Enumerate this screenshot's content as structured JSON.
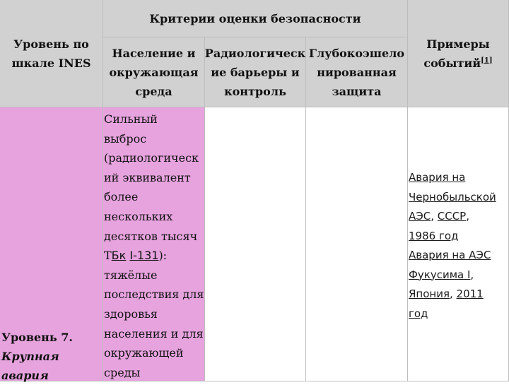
{
  "header": {
    "level_col": [
      "Уровень по",
      "шкале INES"
    ],
    "criteria": "Критерии оценки безопасности",
    "population_col": [
      "Население и",
      "окружающая",
      "среда"
    ],
    "radiological_col": [
      "Радиологическ",
      "ие барьеры и",
      "контроль"
    ],
    "deep_col": [
      "Глубокоэшело",
      "нированная",
      "защита"
    ],
    "examples_col": [
      "Примеры",
      "событий"
    ],
    "examples_ref": "[1]"
  },
  "row7": {
    "level_title": "Уровень 7.",
    "level_subtitle": "Крупная авария",
    "description": {
      "lines_before": [
        "Сильный",
        "выброс",
        "(радиологическ",
        "ий эквивалент",
        "более",
        "нескольких",
        "десятков тысяч"
      ],
      "unit_prefix": "Т",
      "unit_link": "Бк",
      "isotope_link": "I-131",
      "after_isotope": "):",
      "lines_after": [
        "тяжёлые",
        "последствия для",
        "здоровья",
        "населения и для",
        "окружающей",
        "среды"
      ]
    },
    "examples": {
      "chernobyl": [
        "Авария на",
        "Чернобыльской",
        "АЭС"
      ],
      "ussr": "СССР",
      "year1": "1986 год",
      "fukushima": [
        "Авария на АЭС",
        "Фукусима I"
      ],
      "japan": "Япония",
      "year2_num": "2011",
      "year2_word": "год"
    }
  }
}
